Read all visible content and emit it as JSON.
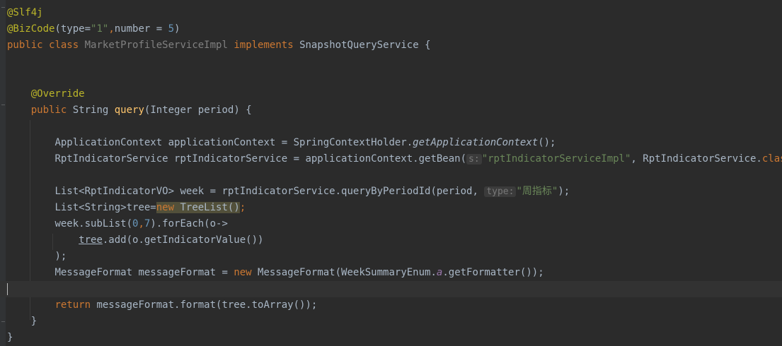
{
  "editor": {
    "lines": {
      "l1": {
        "annotation": "@Slf4j"
      },
      "l2": {
        "annotation": "@BizCode",
        "open": "(",
        "param1": "type",
        "eq1": "=",
        "val1": "\"1\"",
        "comma": ",",
        "param2": "number",
        "eq2": " = ",
        "val2": "5",
        "close": ")"
      },
      "l3": {
        "kw_public": "public",
        "kw_class": "class",
        "class_name": "MarketProfileServiceImpl",
        "kw_implements": "implements",
        "interface": "SnapshotQueryService",
        "brace": "{"
      },
      "l6": {
        "annotation": "@Override"
      },
      "l7": {
        "kw_public": "public",
        "type": "String",
        "method": "query",
        "params": "(Integer period) {"
      },
      "l9": {
        "text_a": "ApplicationContext applicationContext = SpringContextHolder.",
        "static_call": "getApplicationContext",
        "text_b": "();"
      },
      "l10": {
        "text_a": "RptIndicatorService rptIndicatorService = applicationContext.getBean(",
        "hint": "s:",
        "string": "\"rptIndicatorServiceImpl\"",
        "text_b": ", RptIndicatorService.",
        "kw_class": "class",
        "text_c": ");"
      },
      "l12": {
        "text_a": "List<RptIndicatorVO> week = rptIndicatorService.queryByPeriodId(period, ",
        "hint": "type:",
        "string": "\"周指标\"",
        "text_b": ");"
      },
      "l13": {
        "text_a": "List<String>tree=",
        "kw_new": "new",
        "text_b": " TreeList()",
        "text_c": ";"
      },
      "l14": {
        "text_a": "week.subList(",
        "n0": "0",
        "comma": ",",
        "n7": "7",
        "text_b": ").forEach(o->"
      },
      "l15": {
        "var": "tree",
        "text_a": ".add(o.getIndicatorValue())"
      },
      "l16": {
        "text_a": ");"
      },
      "l17": {
        "text_a": "MessageFormat messageFormat = ",
        "kw_new": "new",
        "text_b": " MessageFormat(WeekSummaryEnum.",
        "enum_const": "a",
        "text_c": ".getFormatter());"
      },
      "l19": {
        "kw_return": "return",
        "text_a": " messageFormat.format(tree.toArray());"
      },
      "l20": {
        "text_a": "}"
      },
      "l21": {
        "text_a": "}"
      }
    }
  },
  "colors": {
    "background": "#2b2b2b",
    "gutter": "#313335",
    "caret_line": "#323232",
    "keyword": "#cc7832",
    "annotation": "#bbb529",
    "string": "#6a8759",
    "number": "#6897bb",
    "method_decl": "#ffc66d",
    "enum_const": "#9876aa",
    "default_text": "#a9b7c6"
  }
}
